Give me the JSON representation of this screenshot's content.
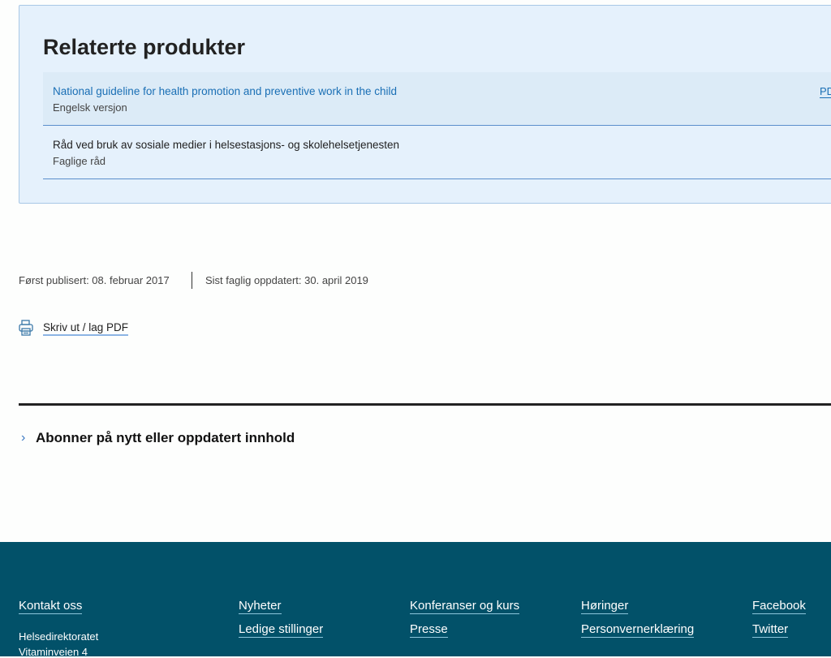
{
  "related": {
    "title": "Relaterte produkter",
    "items": [
      {
        "title": "National guideline for health promotion and preventive work in the child",
        "subtitle": "Engelsk versjon",
        "badge": "PDF"
      },
      {
        "title": "Råd ved bruk av sosiale medier i helsestasjons- og skolehelsetjenesten",
        "subtitle": "Faglige råd"
      }
    ]
  },
  "meta": {
    "published": "Først publisert: 08. februar 2017",
    "updated": "Sist faglig oppdatert: 30. april 2019"
  },
  "print": {
    "label": "Skriv ut / lag PDF",
    "icon": "printer-icon"
  },
  "subscribe": {
    "label": "Abonner på nytt eller oppdatert innhold",
    "icon": "chevron-right-icon"
  },
  "footer": {
    "contact": "Kontakt oss",
    "org": "Helsedirektoratet",
    "address": "Vitaminveien 4",
    "links": [
      "Nyheter",
      "Ledige stillinger",
      "Konferanser og kurs",
      "Presse",
      "Høringer",
      "Personvernerklæring",
      "Facebook",
      "Twitter"
    ],
    "background": "#025169"
  }
}
